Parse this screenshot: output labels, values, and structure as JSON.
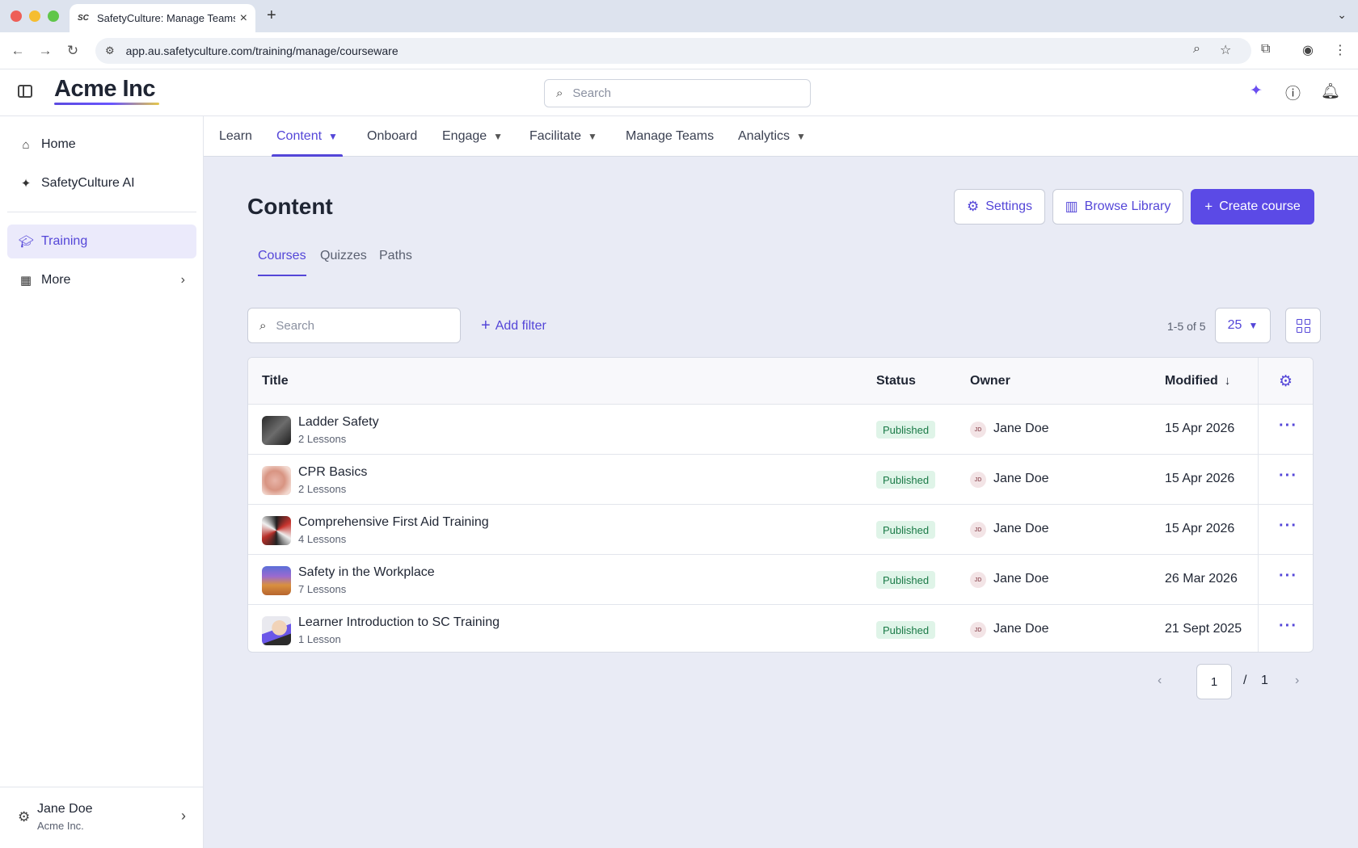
{
  "browser": {
    "tab_title": "SafetyCulture: Manage Teams",
    "favicon": "SC",
    "url": "app.au.safetyculture.com/training/manage/courseware"
  },
  "header": {
    "brand": "Acme Inc",
    "search_placeholder": "Search"
  },
  "sidebar": {
    "items": [
      {
        "label": "Home",
        "icon": "home-icon"
      },
      {
        "label": "SafetyCulture AI",
        "icon": "sparkle-icon"
      },
      {
        "label": "Training",
        "icon": "graduation-cap-icon"
      },
      {
        "label": "More",
        "icon": "grid-icon"
      }
    ],
    "footer": {
      "name": "Jane Doe",
      "org": "Acme Inc."
    }
  },
  "topnav": {
    "items": [
      "Learn",
      "Content",
      "Onboard",
      "Engage",
      "Facilitate",
      "Manage Teams",
      "Analytics"
    ],
    "active": "Content"
  },
  "page": {
    "title": "Content",
    "settings_label": "Settings",
    "browse_label": "Browse Library",
    "create_label": "Create course",
    "tabs": [
      "Courses",
      "Quizzes",
      "Paths"
    ],
    "search_placeholder": "Search",
    "add_filter_label": "Add filter",
    "range": "1-5 of 5",
    "page_size": "25"
  },
  "table": {
    "headers": {
      "title": "Title",
      "status": "Status",
      "owner": "Owner",
      "modified": "Modified"
    },
    "rows": [
      {
        "title": "Ladder Safety",
        "lessons": "2 Lessons",
        "status": "Published",
        "owner_initials": "JD",
        "owner": "Jane Doe",
        "modified": "15 Apr 2026"
      },
      {
        "title": "CPR Basics",
        "lessons": "2 Lessons",
        "status": "Published",
        "owner_initials": "JD",
        "owner": "Jane Doe",
        "modified": "15 Apr 2026"
      },
      {
        "title": "Comprehensive First Aid Training",
        "lessons": "4 Lessons",
        "status": "Published",
        "owner_initials": "JD",
        "owner": "Jane Doe",
        "modified": "15 Apr 2026"
      },
      {
        "title": "Safety in the Workplace",
        "lessons": "7 Lessons",
        "status": "Published",
        "owner_initials": "JD",
        "owner": "Jane Doe",
        "modified": "26 Mar 2026"
      },
      {
        "title": "Learner Introduction to SC Training",
        "lessons": "1 Lesson",
        "status": "Published",
        "owner_initials": "JD",
        "owner": "Jane Doe",
        "modified": "21 Sept 2025"
      }
    ]
  },
  "pagination": {
    "current": "1",
    "separator": "/",
    "total": "1"
  },
  "colors": {
    "accent": "#5446d8",
    "primary_button": "#5b4ae6",
    "published_bg": "#dff4e8",
    "published_text": "#1a7a47"
  }
}
